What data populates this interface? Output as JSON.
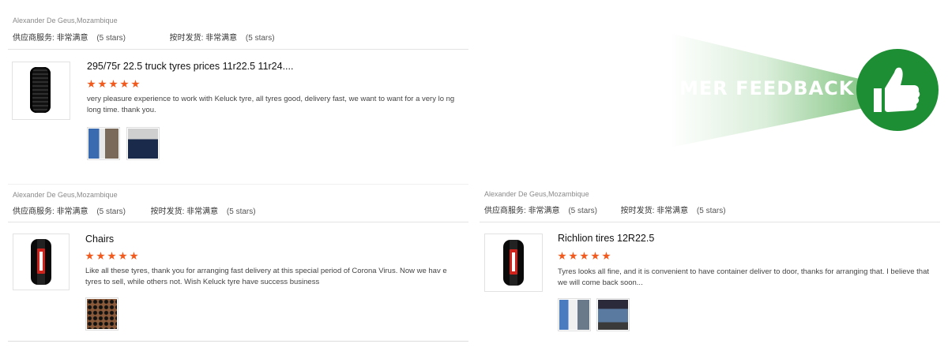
{
  "banner": {
    "text": "MER FEEDBACK",
    "icon": "thumbs-up-icon",
    "circle_color": "#1e8e34"
  },
  "review_labels": {
    "supplier_service": "供应商服务:",
    "on_time_shipment": "按时发货:",
    "rating_word": "非常满意",
    "stars_note": "(5 stars)"
  },
  "reviews": [
    {
      "reviewer": "Alexander De Geus,Mozambique",
      "product_icon": "truck-tire-icon",
      "title": "295/75r 22.5 truck tyres prices 11r22.5 11r24....",
      "rating": 5,
      "text": "very pleasure experience to work with Keluck tyre, all tyres good, delivery fast, we want to want for a very lo ng long time. thank you.",
      "photos": [
        "warehouse-photo",
        "loading-photo"
      ]
    },
    {
      "reviewer": "Alexander De Geus,Mozambique",
      "product_icon": "car-tire-icon",
      "title": "Chairs",
      "rating": 5,
      "text": "Like all these tyres, thank you for arranging fast delivery at this special period of Corona Virus. Now we hav e tyres to sell, while others not. Wish Keluck tyre have success business",
      "photos": [
        "tire-stack-photo"
      ]
    },
    {
      "reviewer": "Alexander De Geus,Mozambique",
      "product_icon": "car-tire-icon",
      "title": "Richlion tires 12R22.5",
      "rating": 5,
      "text": "Tyres looks all fine, and it is convenient to have container deliver to door, thanks for arranging that. I believe that we will come back soon...",
      "photos": [
        "container-photo",
        "delivery-photo"
      ]
    }
  ],
  "colors": {
    "star": "#f25a1d",
    "tire_label": "#d1211b"
  }
}
